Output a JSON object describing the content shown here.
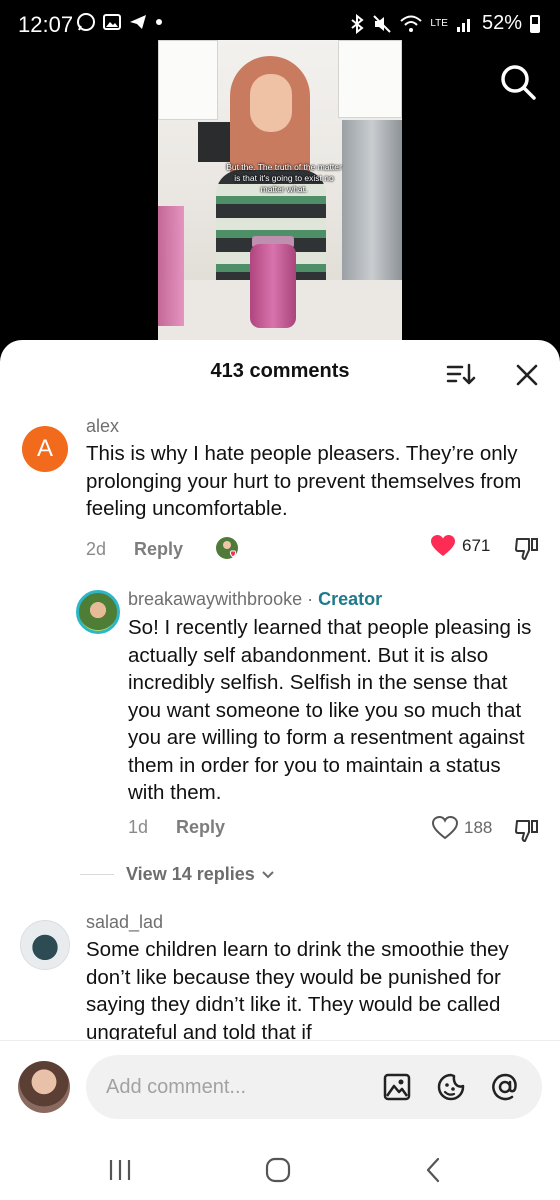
{
  "status_bar": {
    "time": "12:07",
    "battery": "52%",
    "network": "LTE"
  },
  "video": {
    "caption": "But the. The truth of the matter is that it's going to exist no matter what."
  },
  "comments_panel": {
    "count_label": "413 comments",
    "comments": [
      {
        "username": "alex",
        "avatar_letter": "A",
        "avatar_color": "#f26a1b",
        "text": "This is why I hate people pleasers. They’re only prolonging your hurt to prevent themselves from feeling uncomfortable.",
        "age": "2d",
        "reply_label": "Reply",
        "likes": "671"
      },
      {
        "username": "breakawaywithbrooke",
        "separator": "·",
        "badge": "Creator",
        "text": "So! I recently learned that people pleasing is actually self abandonment. But it is also incredibly selfish. Selfish in the sense that you want someone to like you so much that you are willing to form a resentment against them in order for you to maintain a status with them.",
        "age": "1d",
        "reply_label": "Reply",
        "likes": "188"
      },
      {
        "username": "salad_lad",
        "text": "Some children learn to drink the smoothie they don’t like because they would be punished for saying they didn’t like it. They would be called ungrateful and told that if"
      }
    ],
    "view_replies_label": "View 14 replies"
  },
  "input": {
    "placeholder": "Add comment..."
  },
  "colors": {
    "heart_active": "#fe2c55",
    "creator_badge": "#1f7a8c"
  }
}
